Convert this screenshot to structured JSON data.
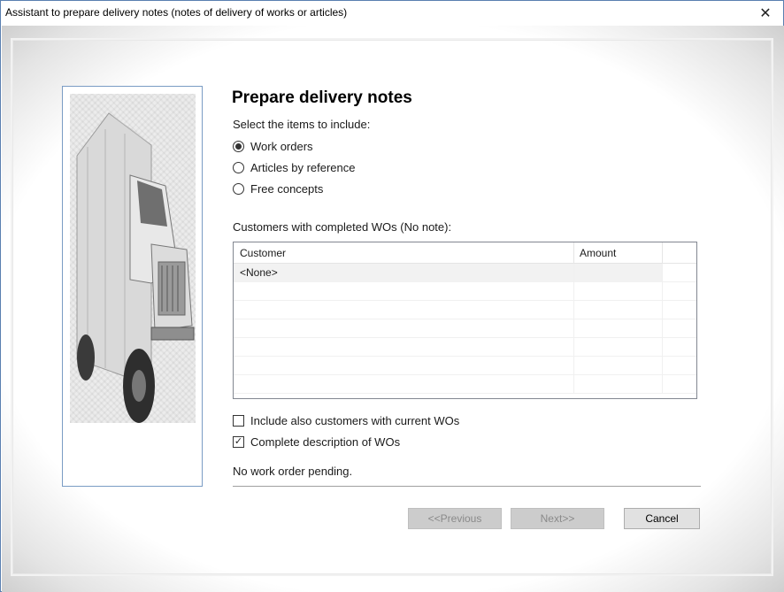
{
  "window": {
    "title": "Assistant to prepare delivery notes (notes of delivery of works or articles)",
    "close_glyph": "✕"
  },
  "wizard": {
    "heading": "Prepare delivery notes",
    "select_label": "Select the items to include:",
    "options": [
      {
        "label": "Work orders",
        "selected": true
      },
      {
        "label": "Articles by reference",
        "selected": false
      },
      {
        "label": "Free concepts",
        "selected": false
      }
    ],
    "customers_label": "Customers with completed WOs (No note):",
    "table": {
      "columns": [
        "Customer",
        "Amount"
      ],
      "rows": [
        {
          "customer": "<None>",
          "amount": ""
        }
      ]
    },
    "include_current": {
      "label": "Include also customers with current WOs",
      "checked": false
    },
    "complete_description": {
      "label": "Complete description of WOs",
      "checked": true
    },
    "status": "No work order pending."
  },
  "buttons": {
    "previous": "<<Previous",
    "next": "Next>>",
    "cancel": "Cancel"
  },
  "icons": {
    "illustration": "delivery-truck-icon"
  }
}
